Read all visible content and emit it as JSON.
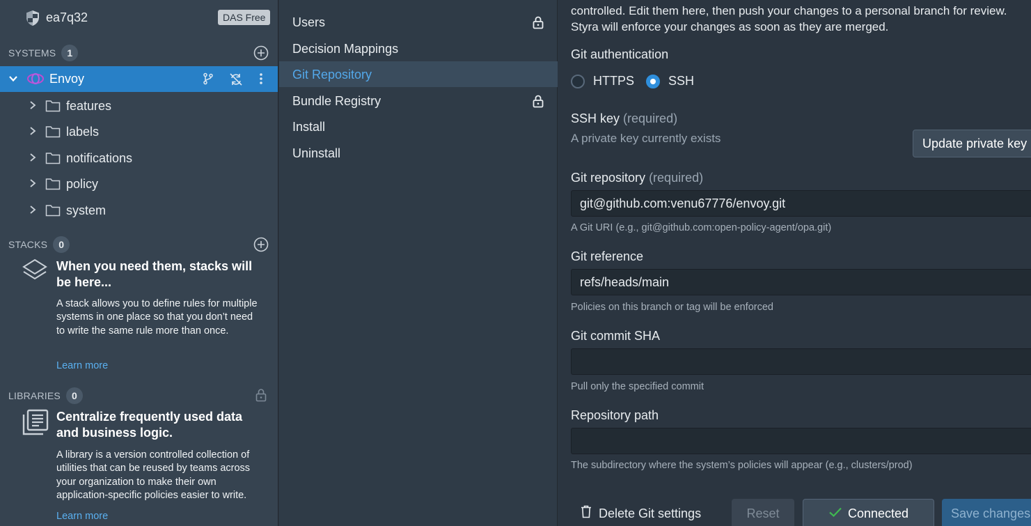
{
  "tenant": {
    "name": "ea7q32",
    "plan": "DAS Free"
  },
  "systems": {
    "heading": "SYSTEMS",
    "count": "1",
    "selected": {
      "name": "Envoy"
    },
    "folders": [
      "features",
      "labels",
      "notifications",
      "policy",
      "system"
    ]
  },
  "stacks": {
    "heading": "STACKS",
    "count": "0",
    "empty_title": "When you need them, stacks will be here...",
    "empty_desc": "A stack allows you to define rules for multiple systems in one place so that you don’t need to write the same rule more than once.",
    "learn_more": "Learn more"
  },
  "libraries": {
    "heading": "LIBRARIES",
    "count": "0",
    "empty_title": "Centralize frequently used data and business logic.",
    "empty_desc": "A library is a version controlled collection of utilities that can be reused by teams across your organization to make their own application-specific policies easier to write.",
    "learn_more": "Learn more"
  },
  "nav": {
    "items": [
      {
        "label": "Users",
        "locked": true
      },
      {
        "label": "Decision Mappings",
        "locked": false
      },
      {
        "label": "Git Repository",
        "locked": false,
        "active": true
      },
      {
        "label": "Bundle Registry",
        "locked": true
      },
      {
        "label": "Install",
        "locked": false
      },
      {
        "label": "Uninstall",
        "locked": false
      }
    ]
  },
  "git": {
    "intro": "controlled. Edit them here, then push your changes to a personal branch for review. Styra will enforce your changes as soon as they are merged.",
    "auth_label": "Git authentication",
    "auth_options": [
      "HTTPS",
      "SSH"
    ],
    "auth_selected": "SSH",
    "ssh_key_label": "SSH key",
    "required": "(required)",
    "ssh_key_status": "A private key currently exists",
    "update_key_button": "Update private key",
    "repo_label": "Git repository",
    "repo_value": "git@github.com:venu67776/envoy.git",
    "repo_help": "A Git URI (e.g., git@github.com:open-policy-agent/opa.git)",
    "ref_label": "Git reference",
    "ref_value": "refs/heads/main",
    "ref_help": "Policies on this branch or tag will be enforced",
    "sha_label": "Git commit SHA",
    "sha_value": "",
    "sha_help": "Pull only the specified commit",
    "path_label": "Repository path",
    "path_value": "",
    "path_help": "The subdirectory where the system’s policies will appear (e.g., clusters/prod)"
  },
  "footer": {
    "delete_label": "Delete Git settings",
    "reset_label": "Reset",
    "connected_label": "Connected",
    "save_label": "Save changes"
  },
  "colors": {
    "accent": "#2880c7",
    "link": "#5ab0f0",
    "success": "#3fb950"
  }
}
